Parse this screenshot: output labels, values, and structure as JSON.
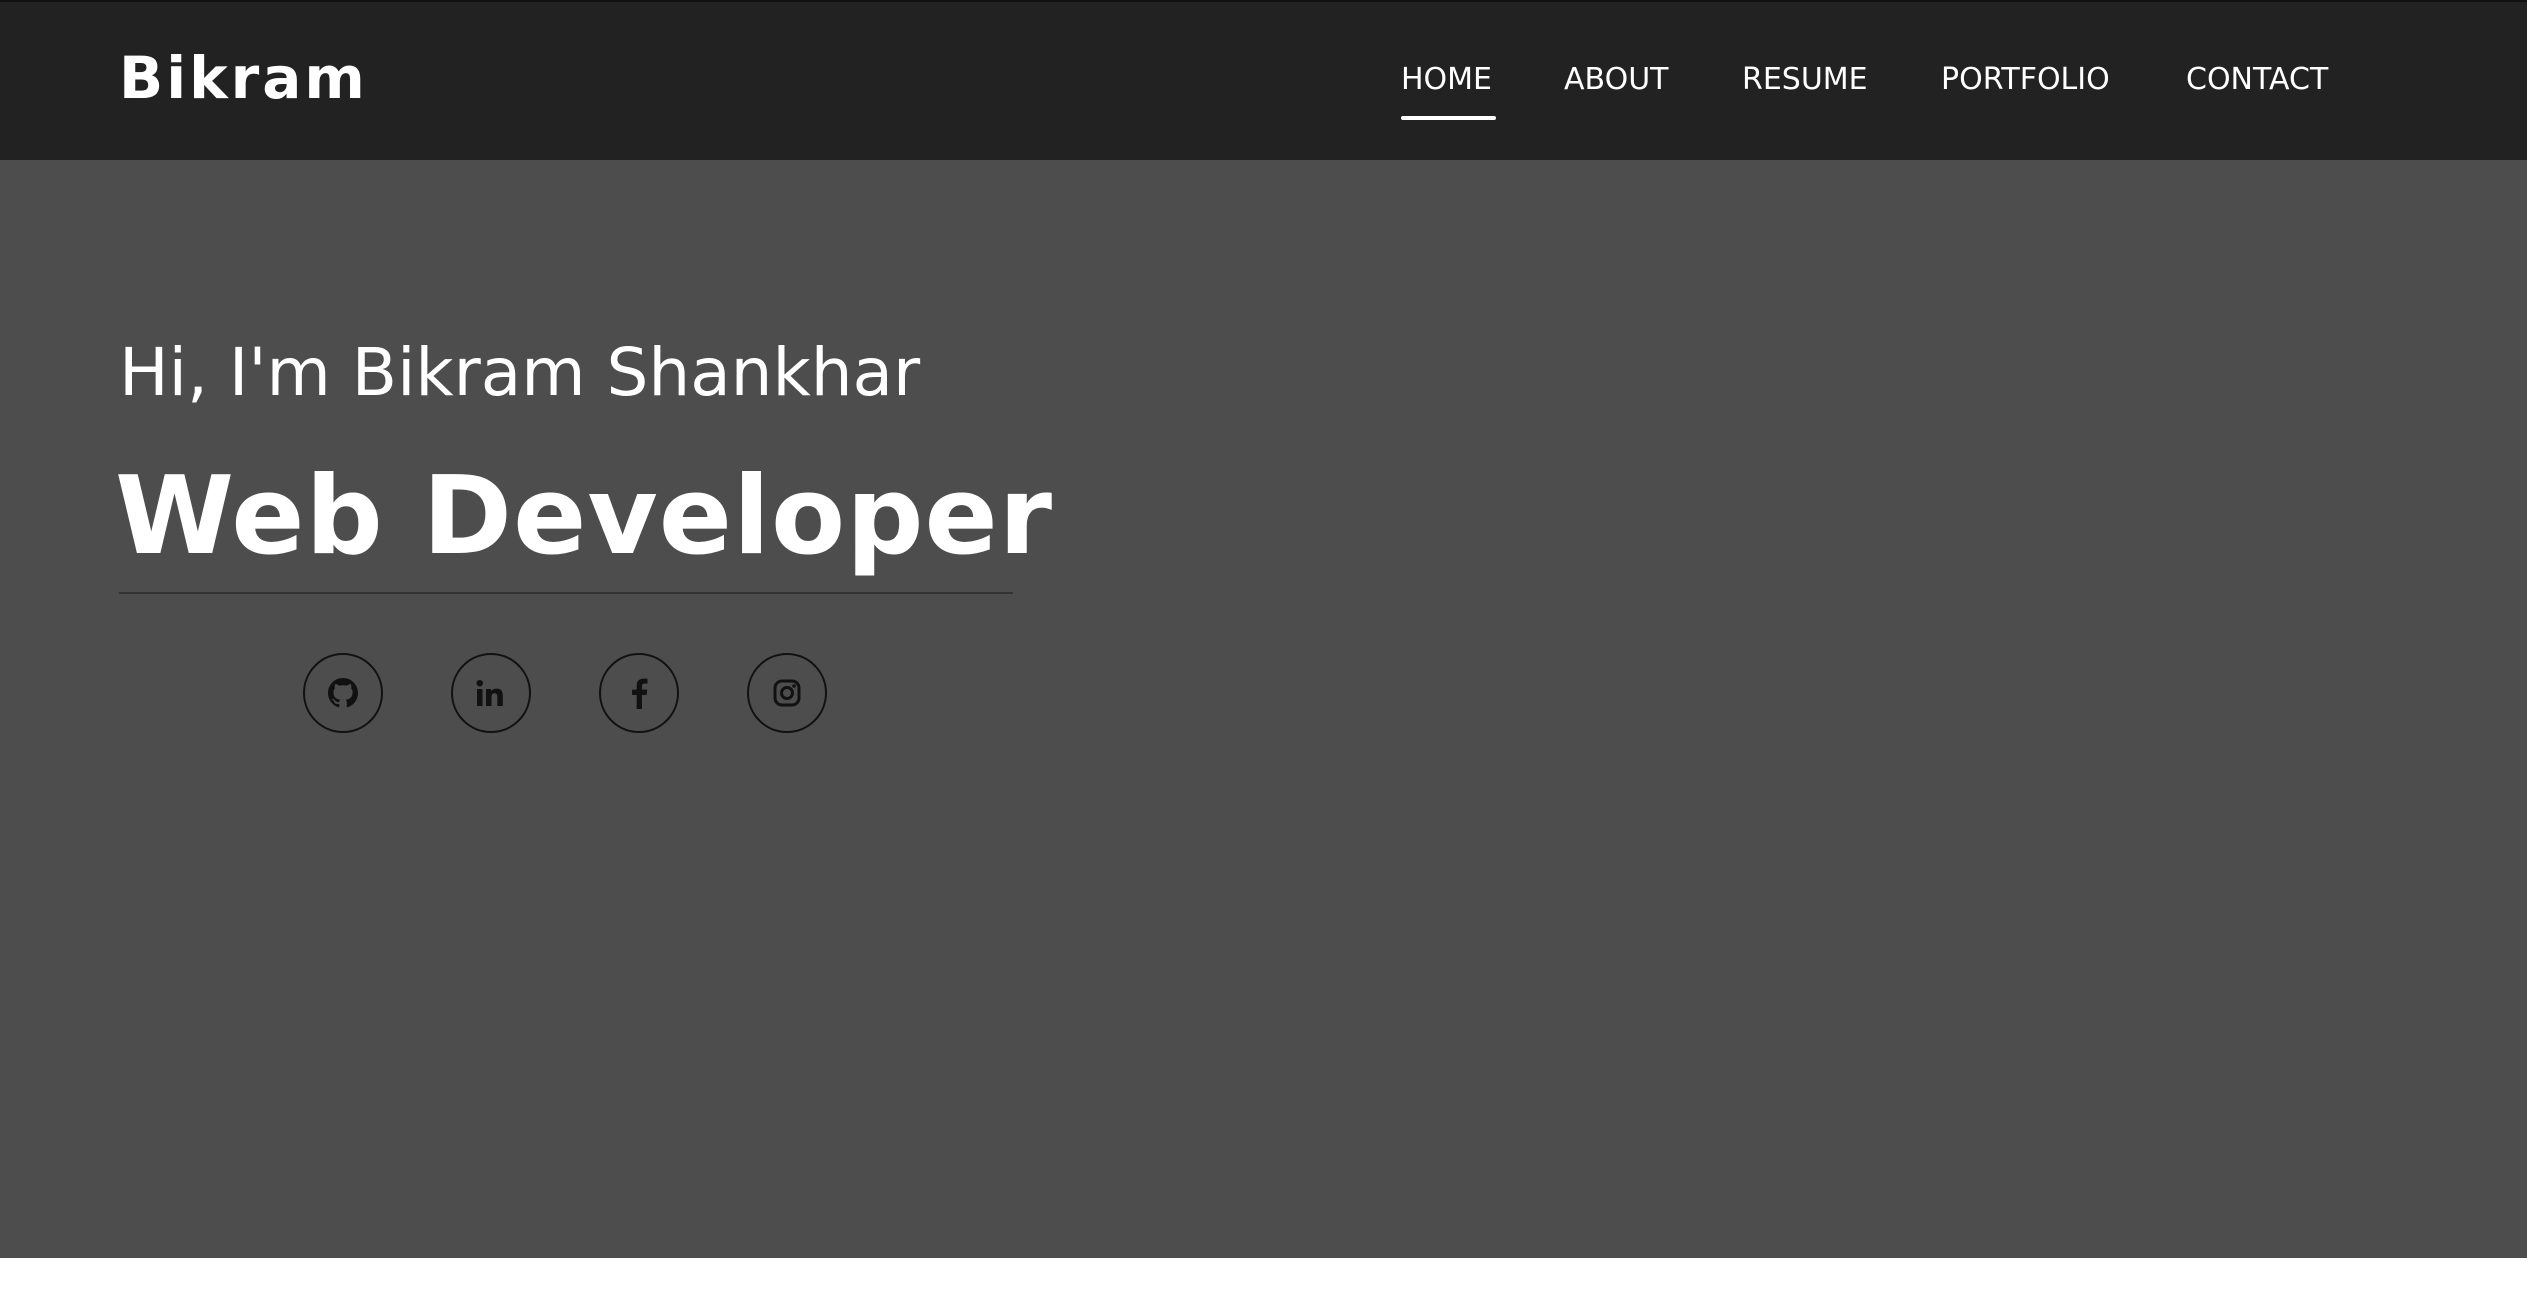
{
  "navbar": {
    "brand": "Bikram",
    "links": [
      {
        "label": "HOME",
        "active": true
      },
      {
        "label": "ABOUT",
        "active": false
      },
      {
        "label": "RESUME",
        "active": false
      },
      {
        "label": "PORTFOLIO",
        "active": false
      },
      {
        "label": "CONTACT",
        "active": false
      }
    ]
  },
  "hero": {
    "greeting": "Hi, I'm Bikram Shankhar",
    "role": "Web Developer",
    "social": [
      {
        "icon": "github-icon"
      },
      {
        "icon": "linkedin-icon"
      },
      {
        "icon": "facebook-icon"
      },
      {
        "icon": "instagram-icon"
      }
    ]
  },
  "colors": {
    "navbar_bg": "#222222",
    "hero_bg": "#4d4d4d",
    "text": "#ffffff",
    "icon_stroke": "#111111"
  }
}
